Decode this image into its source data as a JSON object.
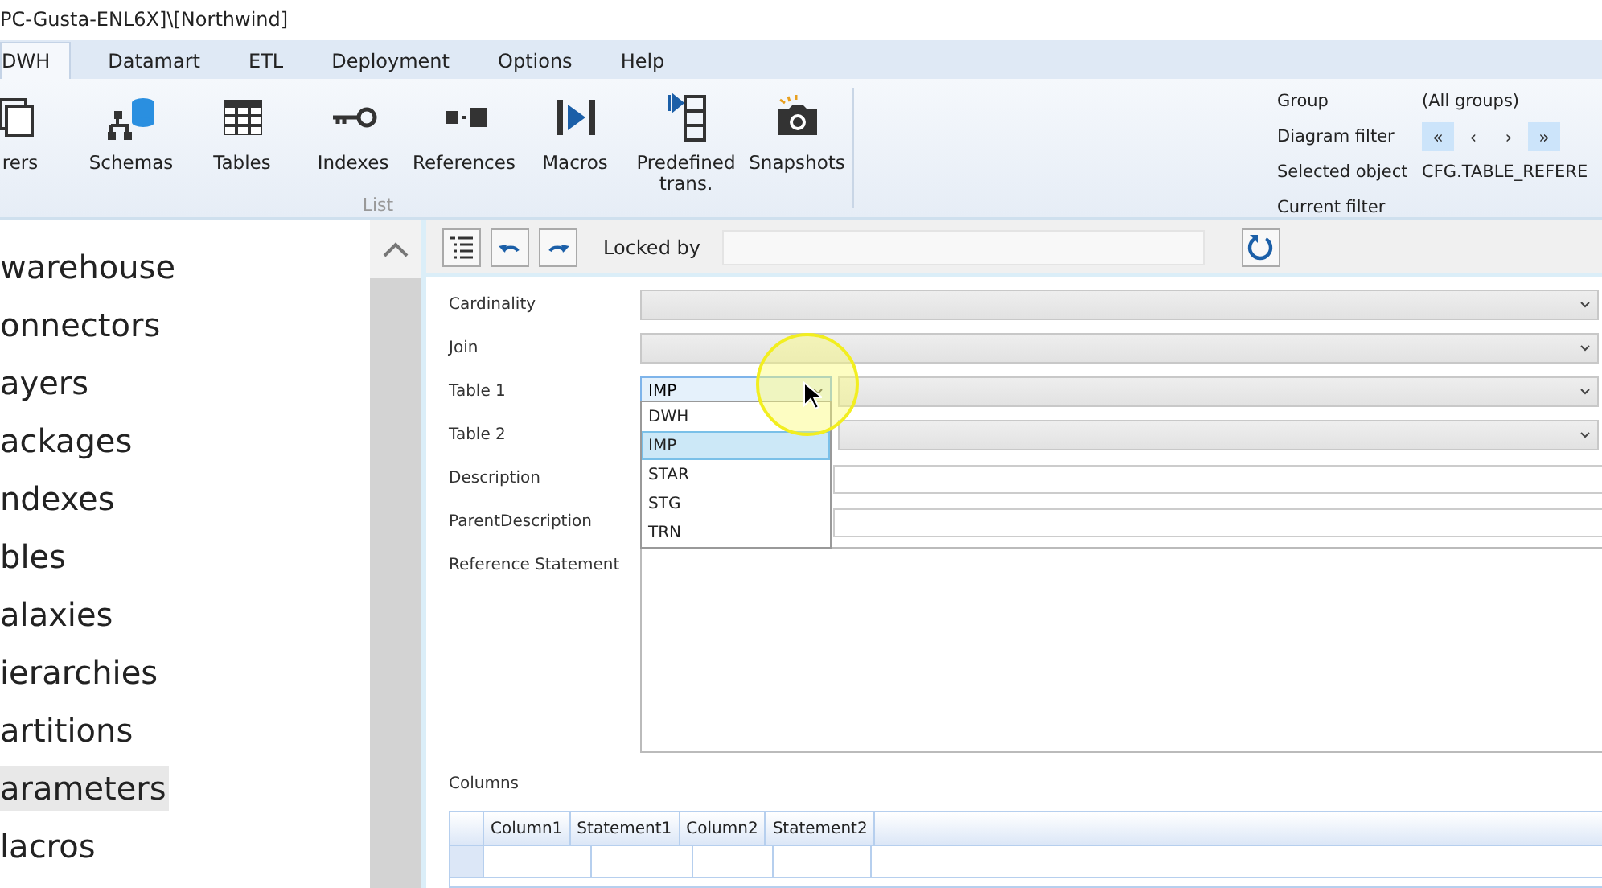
{
  "window": {
    "title": "PC-Gusta-ENL6X]\\[Northwind]"
  },
  "menu_tabs": [
    {
      "label": "DWH",
      "selected": true
    },
    {
      "label": "Datamart",
      "selected": false
    },
    {
      "label": "ETL",
      "selected": false
    },
    {
      "label": "Deployment",
      "selected": false
    },
    {
      "label": "Options",
      "selected": false
    },
    {
      "label": "Help",
      "selected": false
    }
  ],
  "ribbon": {
    "buttons": [
      {
        "label": "rers",
        "kind": "layers"
      },
      {
        "label": "Schemas",
        "kind": "schemas"
      },
      {
        "label": "Tables",
        "kind": "tables"
      },
      {
        "label": "Indexes",
        "kind": "indexes"
      },
      {
        "label": "References",
        "kind": "references"
      },
      {
        "label": "Macros",
        "kind": "macros"
      },
      {
        "label": "Predefined trans.",
        "kind": "predefined"
      },
      {
        "label": "Snapshots",
        "kind": "snapshots"
      }
    ],
    "group_label": "List",
    "filter_panel": {
      "group_label": "Group",
      "group_value": "(All groups)",
      "diagram_filter_label": "Diagram filter",
      "nav_buttons": [
        {
          "glyph": "«",
          "highlighted": true
        },
        {
          "glyph": "‹",
          "highlighted": false
        },
        {
          "glyph": "›",
          "highlighted": false
        },
        {
          "glyph": "»",
          "highlighted": true
        }
      ],
      "selected_object_label": "Selected object",
      "selected_object_value": "CFG.TABLE_REFERE",
      "current_filter_label": "Current filter"
    }
  },
  "tree": {
    "items": [
      {
        "label": "warehouse",
        "selected": false
      },
      {
        "label": "onnectors",
        "selected": false
      },
      {
        "label": "ayers",
        "selected": false
      },
      {
        "label": "ackages",
        "selected": false
      },
      {
        "label": "ndexes",
        "selected": false
      },
      {
        "label": "bles",
        "selected": false
      },
      {
        "label": "alaxies",
        "selected": false
      },
      {
        "label": "ierarchies",
        "selected": false
      },
      {
        "label": "artitions",
        "selected": false
      },
      {
        "label": "arameters",
        "selected": true
      },
      {
        "label": "lacros",
        "selected": false
      }
    ]
  },
  "toolbar": {
    "locked_by_label": "Locked by"
  },
  "form": {
    "fields": [
      {
        "label": "Cardinality",
        "kind": "combo"
      },
      {
        "label": "Join",
        "kind": "combo"
      },
      {
        "label": "Table 1",
        "kind": "combo_pair",
        "value": "IMP"
      },
      {
        "label": "Table 2",
        "kind": "combo_pair"
      },
      {
        "label": "Description",
        "kind": "text"
      },
      {
        "label": "ParentDescription",
        "kind": "text"
      },
      {
        "label": "Reference Statement",
        "kind": "textarea"
      }
    ],
    "dropdown": {
      "options": [
        {
          "label": "DWH",
          "selected": false
        },
        {
          "label": "IMP",
          "selected": true
        },
        {
          "label": "STAR",
          "selected": false
        },
        {
          "label": "STG",
          "selected": false
        },
        {
          "label": "TRN",
          "selected": false
        }
      ]
    },
    "columns_label": "Columns",
    "grid": {
      "columns": [
        "Column1",
        "Statement1",
        "Column2",
        "Statement2"
      ]
    }
  }
}
